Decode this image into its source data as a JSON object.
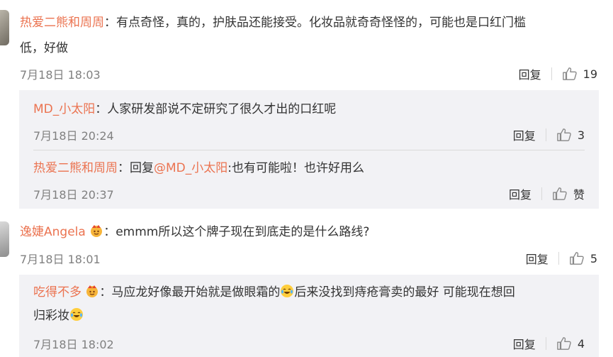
{
  "comments": [
    {
      "user": "热爱二熊和周周",
      "text_line1": "：有点奇怪，真的，护肤品还能接受。化妆品就奇奇怪怪的，可能也是口红门槛",
      "text_line2": "低，好做",
      "time": "7月18日 18:03",
      "reply_label": "回复",
      "likes": "19",
      "replies": [
        {
          "user": "MD_小太阳",
          "text": "：人家研发部说不定研究了很久才出的口红呢",
          "time": "7月18日 20:24",
          "reply_label": "回复",
          "likes": "3"
        },
        {
          "user": "热爱二熊和周周",
          "text_prefix": "：回复",
          "mention": "@MD_小太阳",
          "text": ":也有可能啦！也许好用么",
          "time": "7月18日 20:37",
          "reply_label": "回复",
          "likes": "赞"
        }
      ]
    },
    {
      "user": "逸婕Angela",
      "text": "：emmm所以这个牌子现在到底走的是什么路线?",
      "time": "7月18日 18:01",
      "reply_label": "回复",
      "likes": "5",
      "replies": [
        {
          "user": "吃得不多",
          "text_a": "：马应龙好像最开始就是做眼霜的",
          "text_b": "后来没找到痔疮膏卖的最好 可能现在想回",
          "text_line2": "归彩妆",
          "time": "7月18日 18:02",
          "reply_label": "回复",
          "likes": "4"
        }
      ]
    }
  ],
  "colors": {
    "username": "#eb7350",
    "text": "#333333",
    "meta": "#808080",
    "reply_bg": "#f2f2f5"
  },
  "icons": [
    "thumbs-up-icon",
    "vip-badge-icon",
    "crying-laughing-emoji"
  ]
}
